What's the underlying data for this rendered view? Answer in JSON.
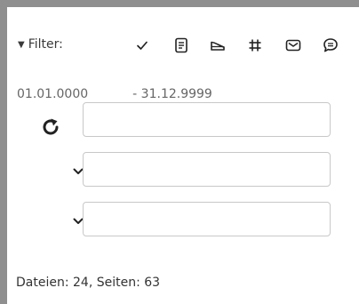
{
  "filter": {
    "toggle_symbol": "▼",
    "label": "Filter:",
    "icons": [
      "check-icon",
      "document-icon",
      "shoe-icon",
      "grid-icon",
      "envelope-icon",
      "comment-icon"
    ]
  },
  "dates": {
    "from": "01.01.0000",
    "separator": "- 31.12.9999"
  },
  "inputs": [
    {
      "name": "field-1",
      "value": ""
    },
    {
      "name": "field-2",
      "value": ""
    },
    {
      "name": "field-3",
      "value": ""
    }
  ],
  "status": {
    "text": "Dateien: 24, Seiten: 63"
  }
}
